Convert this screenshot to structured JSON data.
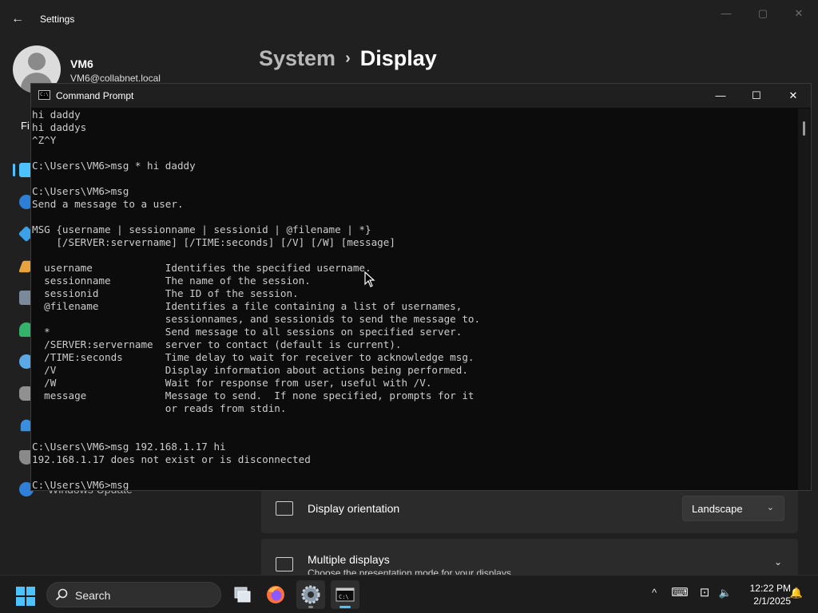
{
  "settings": {
    "window_title": "Settings",
    "back_glyph": "←",
    "controls": {
      "minimize": "—",
      "maximize": "▢",
      "close": "✕"
    },
    "user": {
      "name": "VM6",
      "email": "VM6@collabnet.local"
    },
    "breadcrumb": {
      "parent": "System",
      "separator": "›",
      "current": "Display"
    },
    "search_partial": "Fi",
    "sidebar_update_label": "Windows Update",
    "accent_color": "#4cc2ff",
    "orientation": {
      "label": "Display orientation",
      "value": "Landscape",
      "chevron": "⌄"
    },
    "multiple_displays": {
      "label": "Multiple displays",
      "sub": "Choose the presentation mode for your displays",
      "chevron": "⌄"
    }
  },
  "cmd": {
    "title": "Command Prompt",
    "icon_text": "C:\\",
    "controls": {
      "minimize": "—",
      "maximize": "☐",
      "close": "✕"
    },
    "lines": [
      "hi daddy",
      "hi daddys",
      "^Z^Y",
      "",
      "C:\\Users\\VM6>msg * hi daddy",
      "",
      "C:\\Users\\VM6>msg",
      "Send a message to a user.",
      "",
      "MSG {username | sessionname | sessionid | @filename | *}",
      "    [/SERVER:servername] [/TIME:seconds] [/V] [/W] [message]",
      "",
      "  username            Identifies the specified username.",
      "  sessionname         The name of the session.",
      "  sessionid           The ID of the session.",
      "  @filename           Identifies a file containing a list of usernames,",
      "                      sessionnames, and sessionids to send the message to.",
      "  *                   Send message to all sessions on specified server.",
      "  /SERVER:servername  server to contact (default is current).",
      "  /TIME:seconds       Time delay to wait for receiver to acknowledge msg.",
      "  /V                  Display information about actions being performed.",
      "  /W                  Wait for response from user, useful with /V.",
      "  message             Message to send.  If none specified, prompts for it",
      "                      or reads from stdin.",
      "",
      "",
      "C:\\Users\\VM6>msg 192.168.1.17 hi",
      "192.168.1.17 does not exist or is disconnected",
      "",
      "C:\\Users\\VM6>msg"
    ]
  },
  "taskbar": {
    "search_label": "Search",
    "apps": [
      "task-view-icon",
      "firefox-icon",
      "settings-gear-icon",
      "command-prompt-icon"
    ],
    "tray": {
      "chevron": "^",
      "keyboard": "⌨",
      "network": "⊡",
      "volume": "🔈",
      "notification": "🔔"
    },
    "time": "12:22 PM",
    "date": "2/1/2025"
  }
}
